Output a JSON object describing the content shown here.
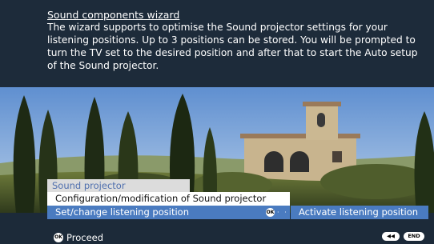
{
  "wizard": {
    "title": "Sound components wizard",
    "description": "The wizard supports to optimise the Sound projector settings for your listening positions. Up to 3 positions can be stored. You will be prompted to turn the TV set to the desired position and after that to start the Auto setup of the Sound projector."
  },
  "menu": {
    "header": "Sound projector",
    "items": [
      {
        "label": "Configuration/modification of Sound projector",
        "selected": false
      },
      {
        "label": "Set/change listening position",
        "selected": true
      }
    ],
    "ok_label": "OK",
    "connector": "· · ·"
  },
  "submenu": {
    "items": [
      {
        "label": "Activate listening position",
        "selected": true
      }
    ]
  },
  "footer": {
    "ok_label": "OK",
    "proceed_label": "Proceed",
    "back_label": "◀◀",
    "end_label": "END"
  },
  "colors": {
    "background": "#1c2a39",
    "highlight": "#4a7bc0",
    "menu_header_bg": "#dcdcdc",
    "menu_header_text": "#4f6fae"
  }
}
